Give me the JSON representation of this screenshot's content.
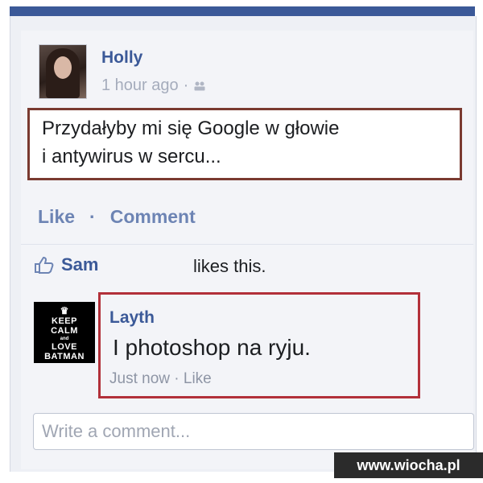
{
  "post": {
    "author": "Holly",
    "time": "1 hour ago",
    "separator": "·",
    "text_line1": "Przydałyby mi się Google w głowie",
    "text_line2": "i antywirus w sercu..."
  },
  "actions": {
    "like": "Like",
    "dot": "·",
    "comment": "Comment"
  },
  "likes": {
    "liker": "Sam",
    "text": "likes this."
  },
  "comment": {
    "avatar_lines": [
      "KEEP",
      "CALM",
      "and",
      "LOVE",
      "BATMAN"
    ],
    "author": "Layth",
    "text": "I photoshop na ryju.",
    "time": "Just now",
    "dot": "·",
    "like": "Like"
  },
  "composer": {
    "placeholder": "Write a comment..."
  },
  "watermark": "www.wiocha.pl",
  "colors": {
    "brand": "#3b5998",
    "post_highlight": "#7a3a30",
    "comment_highlight": "#b2303a"
  }
}
